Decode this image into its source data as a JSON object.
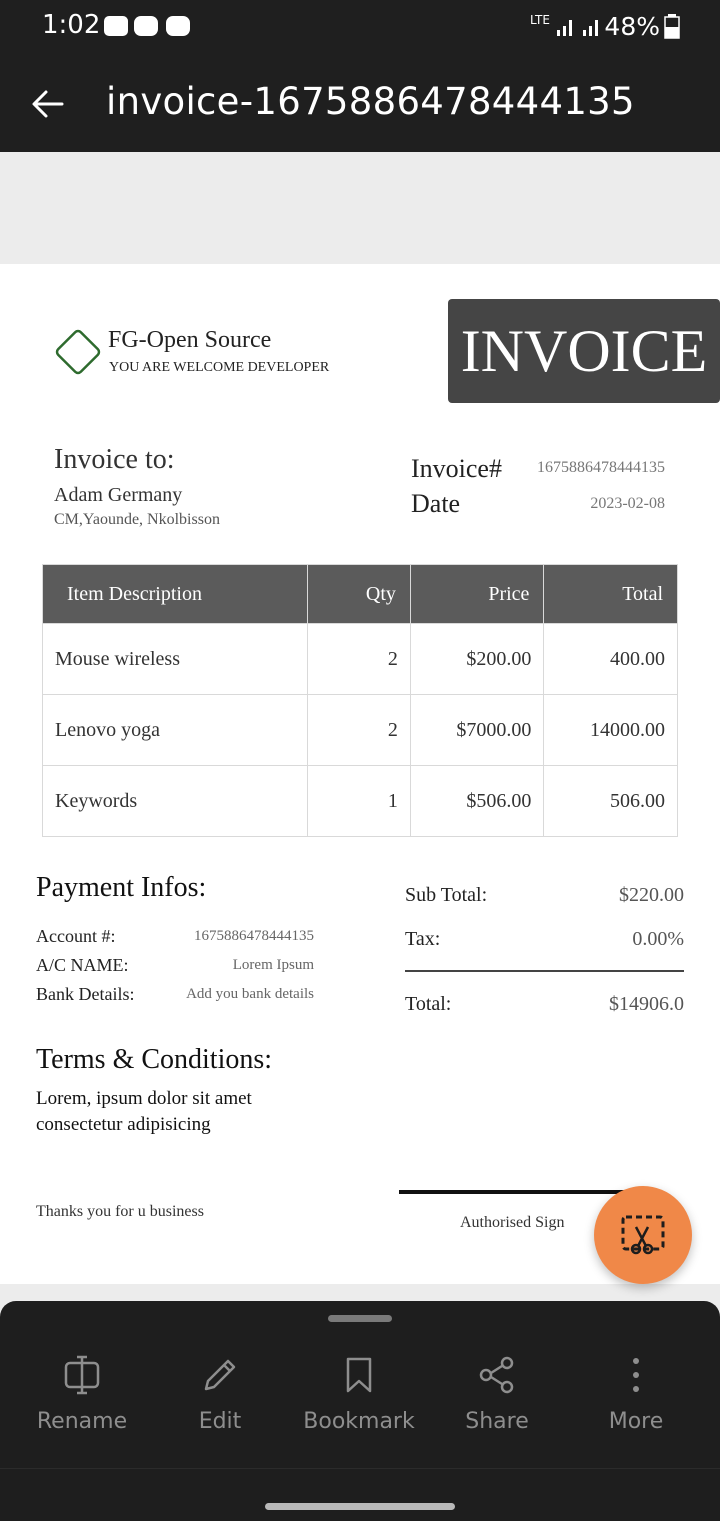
{
  "status_bar": {
    "time": "1:02",
    "network": "LTE",
    "battery": "48%"
  },
  "app_bar": {
    "title": "invoice-1675886478444135"
  },
  "invoice": {
    "company_name": "FG-Open Source",
    "company_tagline": "YOU ARE WELCOME DEVELOPER",
    "banner": "INVOICE",
    "bill_to": {
      "heading": "Invoice to:",
      "name": "Adam Germany",
      "address": "CM,Yaounde, Nkolbisson"
    },
    "meta": {
      "number_label": "Invoice#",
      "number_value": "1675886478444135",
      "date_label": "Date",
      "date_value": "2023-02-08"
    },
    "table": {
      "headers": [
        "Item Description",
        "Qty",
        "Price",
        "Total"
      ],
      "rows": [
        [
          "Mouse wireless",
          "2",
          "$200.00",
          "400.00"
        ],
        [
          "Lenovo yoga",
          "2",
          "$7000.00",
          "14000.00"
        ],
        [
          "Keywords",
          "1",
          "$506.00",
          "506.00"
        ]
      ]
    },
    "payment": {
      "heading": "Payment Infos:",
      "account_label": "Account #:",
      "account_value": "1675886478444135",
      "ac_name_label": "A/C NAME:",
      "ac_name_value": "Lorem Ipsum",
      "bank_label": "Bank Details:",
      "bank_value": "Add you bank details"
    },
    "totals": {
      "subtotal_label": "Sub Total:",
      "subtotal_value": "$220.00",
      "tax_label": "Tax:",
      "tax_value": "0.00%",
      "total_label": "Total:",
      "total_value": "$14906.0"
    },
    "terms": {
      "heading": "Terms & Conditions:",
      "body": "Lorem, ipsum dolor sit amet consectetur adipisicing"
    },
    "thanks": "Thanks you for u business",
    "signature": "Authorised Sign"
  },
  "bottom_actions": [
    {
      "label": "Rename",
      "icon": "rename-icon"
    },
    {
      "label": "Edit",
      "icon": "pencil-icon"
    },
    {
      "label": "Bookmark",
      "icon": "bookmark-icon"
    },
    {
      "label": "Share",
      "icon": "share-icon"
    },
    {
      "label": "More",
      "icon": "more-vertical-icon"
    }
  ],
  "colors": {
    "bar": "#1f1f1f",
    "fab": "#f08848",
    "banner": "#454545",
    "table_header": "#5b5b5b"
  }
}
